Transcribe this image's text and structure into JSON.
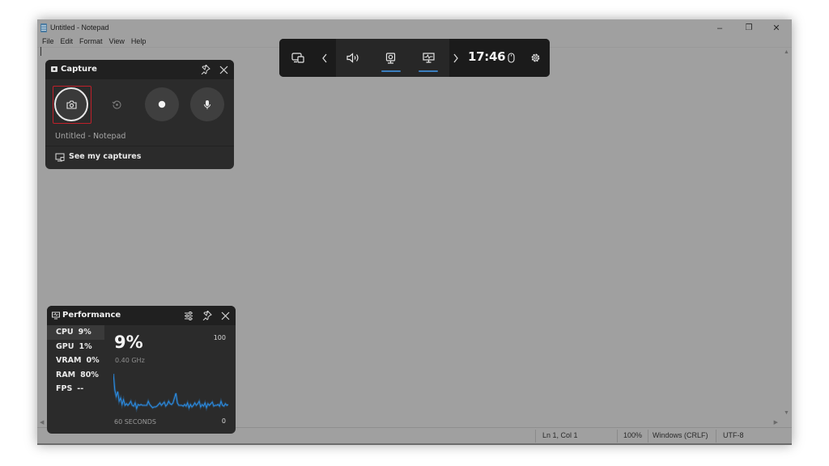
{
  "notepad": {
    "title": "Untitled - Notepad",
    "menu": [
      "File",
      "Edit",
      "Format",
      "View",
      "Help"
    ],
    "controls": {
      "minimize": "–",
      "restore": "❐",
      "close": "✕"
    },
    "status": {
      "position": "Ln 1, Col 1",
      "zoom": "100%",
      "line_ending": "Windows (CRLF)",
      "encoding": "UTF-8"
    }
  },
  "gamebar": {
    "clock": "17:46",
    "buttons": [
      {
        "name": "widget-menu",
        "icon": "widget-menu-icon"
      },
      {
        "name": "previous",
        "icon": "chevron-left-icon"
      },
      {
        "name": "audio",
        "icon": "speaker-icon"
      },
      {
        "name": "capture",
        "icon": "webcam-icon",
        "active": true
      },
      {
        "name": "performance",
        "icon": "monitor-chart-icon",
        "active": true
      },
      {
        "name": "next",
        "icon": "chevron-right-icon"
      },
      {
        "name": "mouse",
        "icon": "mouse-icon"
      },
      {
        "name": "settings",
        "icon": "gear-icon"
      }
    ],
    "accent": "#3c7fbf"
  },
  "capture": {
    "title": "Capture",
    "target": "Untitled - Notepad",
    "see_captures": "See my captures",
    "buttons": [
      {
        "name": "screenshot",
        "icon": "camera-icon",
        "selected": true
      },
      {
        "name": "record-last",
        "icon": "record-last-icon",
        "enabled": false
      },
      {
        "name": "start-recording",
        "icon": "record-dot-icon"
      },
      {
        "name": "microphone",
        "icon": "microphone-icon"
      }
    ],
    "highlight_color": "#c0202a"
  },
  "performance": {
    "title": "Performance",
    "metrics": [
      {
        "label": "CPU",
        "value": "9%",
        "active": true
      },
      {
        "label": "GPU",
        "value": "1%"
      },
      {
        "label": "VRAM",
        "value": "0%"
      },
      {
        "label": "RAM",
        "value": "80%"
      },
      {
        "label": "FPS",
        "value": "--"
      }
    ],
    "big_value": "9%",
    "frequency": "0.40 GHz",
    "axis_max": "100",
    "axis_min": "0",
    "x_label": "60 SECONDS",
    "series_color": "#2a8ae0",
    "cpu_history": [
      48,
      28,
      20,
      26,
      14,
      18,
      10,
      16,
      9,
      11,
      9,
      11,
      14,
      9,
      8,
      12,
      5,
      10,
      9,
      10,
      9,
      9,
      9,
      9,
      14,
      10,
      8,
      6,
      7,
      7,
      8,
      10,
      12,
      9,
      11,
      13,
      8,
      10,
      14,
      11,
      10,
      12,
      18,
      24,
      12,
      9,
      9,
      9,
      8,
      10,
      8,
      12,
      6,
      10,
      7,
      9,
      12,
      9,
      11,
      14,
      7,
      10,
      8,
      12,
      6,
      11,
      9,
      11,
      13,
      8,
      9,
      9,
      10,
      8,
      14,
      9,
      8,
      11,
      9,
      10
    ]
  }
}
